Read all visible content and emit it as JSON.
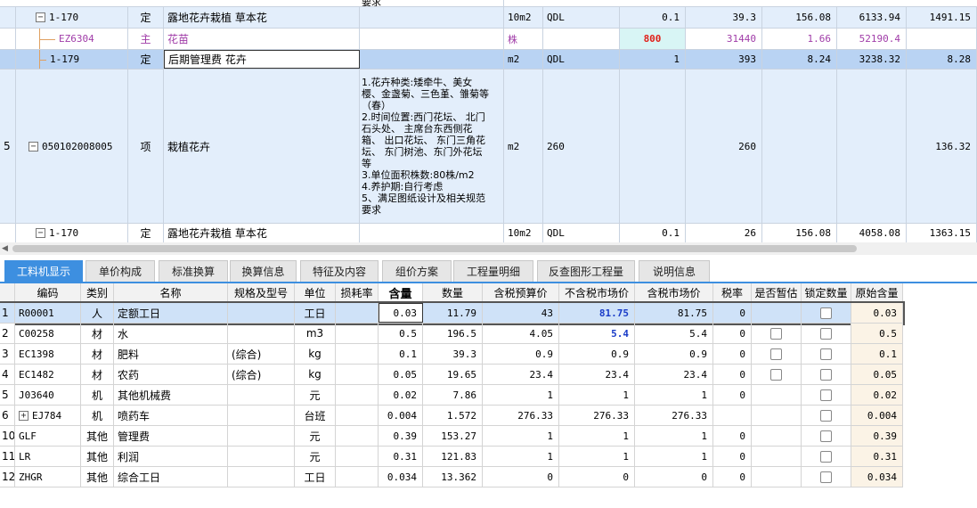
{
  "upper": {
    "top_fragment": "要求",
    "rows": [
      {
        "no": "",
        "code": "1-170",
        "type": "定",
        "name": "露地花卉栽植 草本花",
        "unit": "10m2",
        "qty_expr": "QDL",
        "qty": "0.1",
        "price": "39.3",
        "rate": "156.08",
        "total": "6133.94",
        "labor": "1491.15"
      },
      {
        "no": "",
        "code": "EZ6304",
        "type": "主",
        "name": "花苗",
        "unit": "株",
        "qty_expr": "",
        "qty": "800",
        "price": "31440",
        "rate": "1.66",
        "total": "52190.4",
        "labor": ""
      },
      {
        "no": "",
        "code": "1-179",
        "type": "定",
        "name": "后期管理费 花卉",
        "unit": "m2",
        "qty_expr": "QDL",
        "qty": "1",
        "price": "393",
        "rate": "8.24",
        "total": "3238.32",
        "labor": "8.28"
      },
      {
        "no": "5",
        "code": "050102008005",
        "type": "项",
        "name": "栽植花卉",
        "desc": [
          "1.花卉种类:矮牵牛、美女",
          "樱、金盏菊、三色堇、雏菊等",
          "（春）",
          "2.时间位置:西门花坛、 北门",
          "石头处、 主席台东西侧花",
          "箱、 出口花坛、 东门三角花",
          "坛、 东门树池、东门外花坛",
          "等",
          "3.单位面积株数:80株/m2",
          "4.养护期:自行考虑",
          "5、满足图纸设计及相关规范",
          "要求"
        ],
        "unit": "m2",
        "qty_expr": "260",
        "qty": "",
        "price": "260",
        "rate": "",
        "total": "",
        "labor": "136.32"
      },
      {
        "no": "",
        "code": "1-170",
        "type": "定",
        "name": "露地花卉栽植 草本花",
        "unit": "10m2",
        "qty_expr": "QDL",
        "qty": "0.1",
        "price": "26",
        "rate": "156.08",
        "total": "4058.08",
        "labor": "1363.15"
      }
    ]
  },
  "tabs": [
    "工料机显示",
    "单价构成",
    "标准换算",
    "换算信息",
    "特征及内容",
    "组价方案",
    "工程量明细",
    "反查图形工程量",
    "说明信息"
  ],
  "table": {
    "headers": [
      "编码",
      "类别",
      "名称",
      "规格及型号",
      "单位",
      "损耗率",
      "含量",
      "数量",
      "含税预算价",
      "不含税市场价",
      "含税市场价",
      "税率",
      "是否暂估",
      "锁定数量",
      "原始含量"
    ],
    "rows": [
      {
        "no": "1",
        "code": "R00001",
        "cat": "人",
        "name": "定额工日",
        "spec": "",
        "unit": "工日",
        "loss": "",
        "content": "0.03",
        "qty": "11.79",
        "budget": "43",
        "mkt_ex": "81.75",
        "mkt_in": "81.75",
        "tax": "0",
        "est": false,
        "lock": true,
        "orig": "0.03"
      },
      {
        "no": "2",
        "code": "C00258",
        "cat": "材",
        "name": "水",
        "spec": "",
        "unit": "m3",
        "loss": "",
        "content": "0.5",
        "qty": "196.5",
        "budget": "4.05",
        "mkt_ex": "5.4",
        "mkt_in": "5.4",
        "tax": "0",
        "est": true,
        "lock": true,
        "orig": "0.5"
      },
      {
        "no": "3",
        "code": "EC1398",
        "cat": "材",
        "name": "肥料",
        "spec": "(综合)",
        "unit": "kg",
        "loss": "",
        "content": "0.1",
        "qty": "39.3",
        "budget": "0.9",
        "mkt_ex": "0.9",
        "mkt_in": "0.9",
        "tax": "0",
        "est": true,
        "lock": true,
        "orig": "0.1"
      },
      {
        "no": "4",
        "code": "EC1482",
        "cat": "材",
        "name": "农药",
        "spec": "(综合)",
        "unit": "kg",
        "loss": "",
        "content": "0.05",
        "qty": "19.65",
        "budget": "23.4",
        "mkt_ex": "23.4",
        "mkt_in": "23.4",
        "tax": "0",
        "est": true,
        "lock": true,
        "orig": "0.05"
      },
      {
        "no": "5",
        "code": "J03640",
        "cat": "机",
        "name": "其他机械费",
        "spec": "",
        "unit": "元",
        "loss": "",
        "content": "0.02",
        "qty": "7.86",
        "budget": "1",
        "mkt_ex": "1",
        "mkt_in": "1",
        "tax": "0",
        "est": false,
        "lock": true,
        "orig": "0.02"
      },
      {
        "no": "6",
        "code": "EJ784",
        "cat": "机",
        "name": "喷药车",
        "spec": "",
        "unit": "台班",
        "loss": "",
        "content": "0.004",
        "qty": "1.572",
        "budget": "276.33",
        "mkt_ex": "276.33",
        "mkt_in": "276.33",
        "tax": "",
        "est": false,
        "lock": true,
        "orig": "0.004",
        "expand": true
      },
      {
        "no": "10",
        "code": "GLF",
        "cat": "其他",
        "name": "管理费",
        "spec": "",
        "unit": "元",
        "loss": "",
        "content": "0.39",
        "qty": "153.27",
        "budget": "1",
        "mkt_ex": "1",
        "mkt_in": "1",
        "tax": "0",
        "est": false,
        "lock": true,
        "orig": "0.39"
      },
      {
        "no": "11",
        "code": "LR",
        "cat": "其他",
        "name": "利润",
        "spec": "",
        "unit": "元",
        "loss": "",
        "content": "0.31",
        "qty": "121.83",
        "budget": "1",
        "mkt_ex": "1",
        "mkt_in": "1",
        "tax": "0",
        "est": false,
        "lock": true,
        "orig": "0.31"
      },
      {
        "no": "12",
        "code": "ZHGR",
        "cat": "其他",
        "name": "综合工日",
        "spec": "",
        "unit": "工日",
        "loss": "",
        "content": "0.034",
        "qty": "13.362",
        "budget": "0",
        "mkt_ex": "0",
        "mkt_in": "0",
        "tax": "0",
        "est": false,
        "lock": true,
        "orig": "0.034"
      }
    ]
  },
  "colors": {
    "accent": "#3d8fe0",
    "red": "#e0201a",
    "blue_text": "#1a3cc8",
    "purple": "#a03ca8"
  }
}
